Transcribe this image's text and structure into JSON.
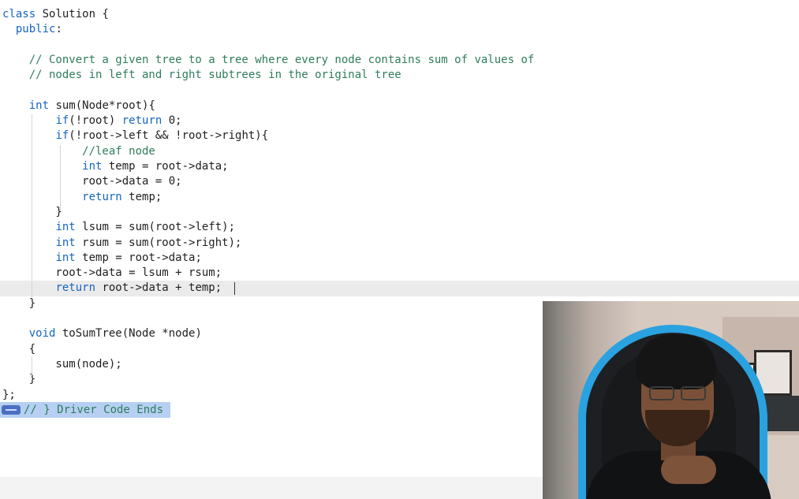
{
  "code_lines": [
    "class Solution {",
    "  public:",
    "",
    "    // Convert a given tree to a tree where every node contains sum of values of",
    "    // nodes in left and right subtrees in the original tree",
    "",
    "    int sum(Node*root){",
    "        if(!root) return 0;",
    "        if(!root->left && !root->right){",
    "            //leaf node",
    "            int temp = root->data;",
    "            root->data = 0;",
    "            return temp;",
    "        }",
    "        int lsum = sum(root->left);",
    "        int rsum = sum(root->right);",
    "        int temp = root->data;",
    "        root->data = lsum + rsum;",
    "        return root->data + temp;",
    "    }",
    "",
    "    void toSumTree(Node *node)",
    "    {",
    "        sum(node);",
    "    }",
    "};",
    "// } Driver Code Ends"
  ],
  "highlighted_line": 18,
  "selected_line": 26,
  "colors": {
    "keyword": "#1565c0",
    "comment": "#2e7d5b",
    "text": "#1f1f1f",
    "selection": "#b6cff2",
    "fold_marker": "#4b6ec2",
    "chair_accent": "#2aa2e0"
  },
  "icons": {
    "fold_marker": "fold-marker-icon"
  }
}
